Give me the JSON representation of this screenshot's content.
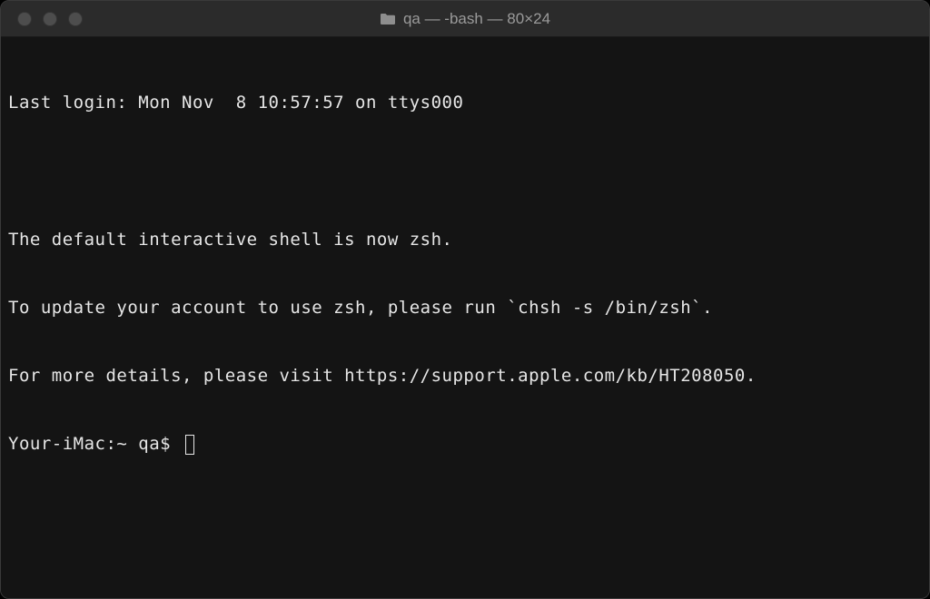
{
  "window": {
    "title": "qa — -bash — 80×24"
  },
  "terminal": {
    "lines": {
      "last_login": "Last login: Mon Nov  8 10:57:57 on ttys000",
      "blank": "",
      "msg1": "The default interactive shell is now zsh.",
      "msg2": "To update your account to use zsh, please run `chsh -s /bin/zsh`.",
      "msg3": "For more details, please visit https://support.apple.com/kb/HT208050."
    },
    "prompt": "Your-iMac:~ qa$ "
  }
}
